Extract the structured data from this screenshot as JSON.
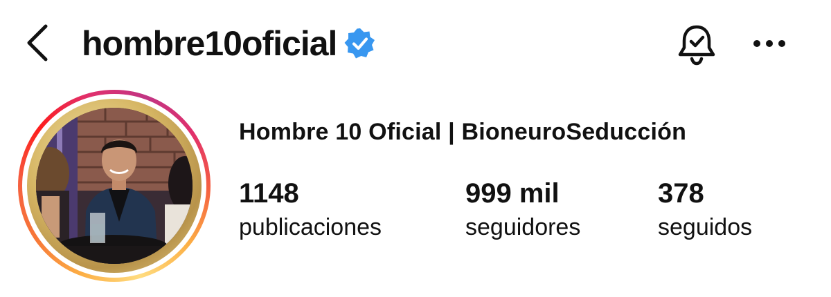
{
  "header": {
    "username": "hombre10oficial",
    "icons": {
      "back": "chevron-left-icon",
      "verified": "verified-badge-icon",
      "notifications": "bell-check-icon",
      "more": "more-horizontal-icon"
    }
  },
  "profile": {
    "display_name": "Hombre 10 Oficial | BioneuroSeducción",
    "avatar": "profile-photo-with-story-ring",
    "stats": {
      "posts": {
        "value": "1148",
        "label": "publicaciones"
      },
      "followers": {
        "value": "999 mil",
        "label": "seguidores"
      },
      "following": {
        "value": "378",
        "label": "seguidos"
      }
    }
  },
  "colors": {
    "text": "#111111",
    "verified_blue": "#3897f0",
    "background": "#ffffff"
  }
}
